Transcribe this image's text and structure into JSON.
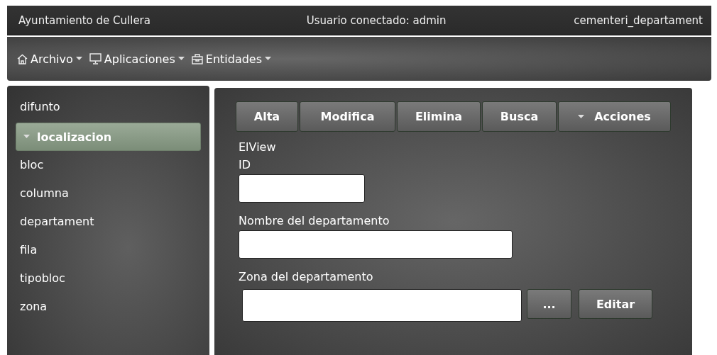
{
  "header": {
    "organization": "Ayuntamiento de Cullera",
    "user": "Usuario conectado: admin",
    "view": "cementeri_departament"
  },
  "menu": [
    {
      "label": "Archivo"
    },
    {
      "label": "Aplicaciones"
    },
    {
      "label": "Entidades"
    }
  ],
  "sidebar": {
    "items": [
      {
        "label": "difunto",
        "selected": false
      },
      {
        "label": "localizacion",
        "selected": true
      },
      {
        "label": "bloc",
        "selected": false
      },
      {
        "label": "columna",
        "selected": false
      },
      {
        "label": "departament",
        "selected": false
      },
      {
        "label": "fila",
        "selected": false
      },
      {
        "label": "tipobloc",
        "selected": false
      },
      {
        "label": "zona",
        "selected": false
      }
    ]
  },
  "toolbar": [
    {
      "label": "Alta",
      "kind": "plain"
    },
    {
      "label": "Modifica",
      "kind": "plain"
    },
    {
      "label": "Elimina",
      "kind": "plain"
    },
    {
      "label": "Busca",
      "kind": "plain"
    },
    {
      "label": "Acciones",
      "kind": "dropdown"
    }
  ],
  "form": {
    "title": "ElView",
    "fields": [
      {
        "label": "ID",
        "kind": "short"
      },
      {
        "label": "Nombre del departamento",
        "kind": "long"
      },
      {
        "label": "Zona del departamento",
        "kind": "lookup",
        "buttons": [
          "...",
          "Editar"
        ]
      }
    ]
  }
}
